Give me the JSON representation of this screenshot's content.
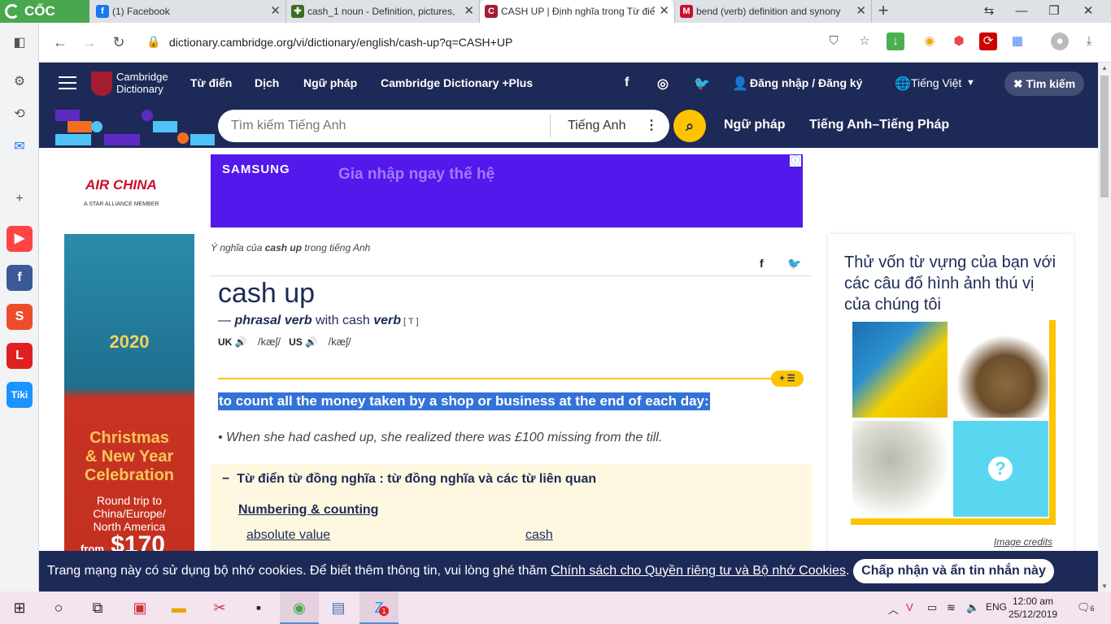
{
  "browser": {
    "brand": "CỐC CỐC",
    "tabs": [
      {
        "title": "(1) Facebook",
        "fav": "f",
        "color": "#1877f2"
      },
      {
        "title": "cash_1 noun - Definition, pictures,",
        "fav": "✚",
        "color": "#3b6e22"
      },
      {
        "title": "CASH UP | Định nghĩa trong Từ điể",
        "fav": "C",
        "color": "#a51c30",
        "active": true
      },
      {
        "title": "bend (verb) definition and synony",
        "fav": "M",
        "color": "#c8102e"
      }
    ],
    "url": "dictionary.cambridge.org/vi/dictionary/english/cash-up?q=CASH+UP",
    "icons": {
      "back": "arrow-left-icon",
      "forward": "arrow-right-icon",
      "reload": "reload-icon",
      "lock": "lock-icon"
    }
  },
  "header": {
    "logo_line1": "Cambridge",
    "logo_line2": "Dictionary",
    "nav": [
      "Từ điển",
      "Dịch",
      "Ngữ pháp",
      "Cambridge Dictionary +Plus"
    ],
    "login": "Đăng nhập / Đăng ký",
    "language": "Tiếng Việt",
    "search_button": "Tìm kiếm"
  },
  "search": {
    "placeholder": "Tìm kiếm Tiếng Anh",
    "dictionary": "Tiếng Anh",
    "links": [
      "Ngữ pháp",
      "Tiếng Anh–Tiếng Pháp"
    ]
  },
  "ads": {
    "airchina_name": "AIR CHINA",
    "airchina_sub": "A STAR ALLIANCE MEMBER",
    "year": "2020",
    "xmas_line1": "Christmas",
    "xmas_line2": "& New Year",
    "xmas_line3": "Celebration",
    "round1": "Round trip to",
    "round2": "China/Europe/",
    "round3": "North America",
    "from": "from",
    "price": "$170",
    "samsung_logo": "SAMSUNG",
    "samsung_tagline": "Gia nhập ngay thế hệ"
  },
  "entry": {
    "breadcrumb_prefix": "Ý nghĩa của ",
    "breadcrumb_word": "cash up",
    "breadcrumb_suffix": " trong tiếng Anh",
    "headword": "cash up",
    "pos_dash": "— ",
    "pos": "phrasal verb",
    "pos_with": " with cash ",
    "pos_verb": "verb",
    "gram": " [ T ]",
    "uk_label": "UK",
    "us_label": "US",
    "uk_ipa": "/kæʃ/",
    "us_ipa": "/kæʃ/",
    "definition": "to count all the money taken by a shop or business at the end of each day:",
    "example": "• When she had cashed up, she realized there was £100 missing from the till."
  },
  "thesaurus": {
    "title": "Từ điển từ đồng nghĩa : từ đồng nghĩa và các từ liên quan",
    "toggle": "−",
    "category": "Numbering & counting",
    "words": [
      "absolute value",
      "cash"
    ]
  },
  "quiz": {
    "title": "Thử vốn từ vựng của bạn với các câu đố hình ảnh thú vị của chúng tôi",
    "credits": "Image credits",
    "question_mark": "?"
  },
  "cookie": {
    "text_before": "Trang mạng này có sử dụng bộ nhớ cookies. Để biết thêm thông tin, vui lòng ghé thăm ",
    "link": "Chính sách cho Quyền riêng tư và Bộ nhớ Cookies",
    "text_after": ".",
    "button": "Chấp nhận và ẩn tin nhắn này"
  },
  "taskbar": {
    "lang": "ENG",
    "time": "12:00 am",
    "date": "25/12/2019",
    "notif_count": "6",
    "zalo_badge": "1"
  },
  "colors": {
    "brand_navy": "#1d2a57",
    "accent_yellow": "#fec400",
    "highlight_blue": "#3373d8",
    "coccoc_green": "#48a74f"
  }
}
